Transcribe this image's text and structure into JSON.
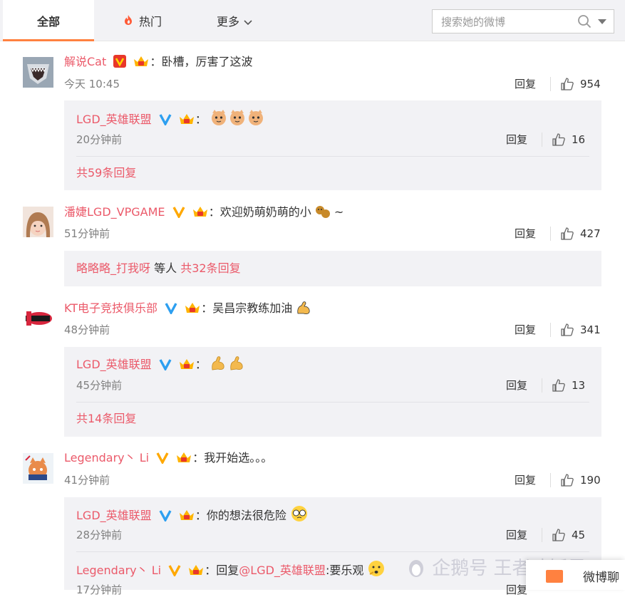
{
  "tabs": {
    "all": "全部",
    "hot": "热门",
    "more": "更多"
  },
  "search": {
    "placeholder": "搜索她的微博"
  },
  "comments": [
    {
      "user": "解说Cat",
      "text": "卧槽，厉害了这波",
      "time": "今天 10:45",
      "reply": "回复",
      "likes": "954",
      "sub": {
        "user": "LGD_英雄联盟",
        "time": "20分钟前",
        "reply": "回复",
        "likes": "16",
        "more": "共59条回复"
      }
    },
    {
      "user": "潘婕LGD_VPGAME",
      "text": "欢迎奶萌奶萌的小",
      "text_tail": "~",
      "time": "51分钟前",
      "reply": "回复",
      "likes": "427",
      "sub": {
        "user": "略略略_打我呀",
        "text": "等人",
        "more": "共32条回复"
      }
    },
    {
      "user": "KT电子竞技俱乐部",
      "text": "吴昌宗教练加油",
      "time": "48分钟前",
      "reply": "回复",
      "likes": "341",
      "sub": {
        "user": "LGD_英雄联盟",
        "time": "45分钟前",
        "reply": "回复",
        "likes": "13",
        "more": "共14条回复"
      }
    },
    {
      "user": "Legendary丶 Li",
      "text": "我开始选。。。",
      "time": "41分钟前",
      "reply": "回复",
      "likes": "190",
      "sub": {
        "user": "LGD_英雄联盟",
        "text": "你的想法很危险",
        "time": "28分钟前",
        "reply": "回复",
        "likes": "45"
      },
      "sub2": {
        "user": "Legendary丶 Li",
        "text_pre": "回复",
        "mention": "@LGD_英雄联盟",
        "text": ":要乐观",
        "time": "17分钟前",
        "reply": "回复"
      }
    }
  ],
  "colon": "：",
  "watermark": "企鹅号 王者喷饭君",
  "chat": "微博聊",
  "colors": {
    "accent": "#ff8140",
    "username": "#eb5a6a",
    "vip_gold": "#ffa800",
    "verified_blue": "#2d9ff0"
  }
}
